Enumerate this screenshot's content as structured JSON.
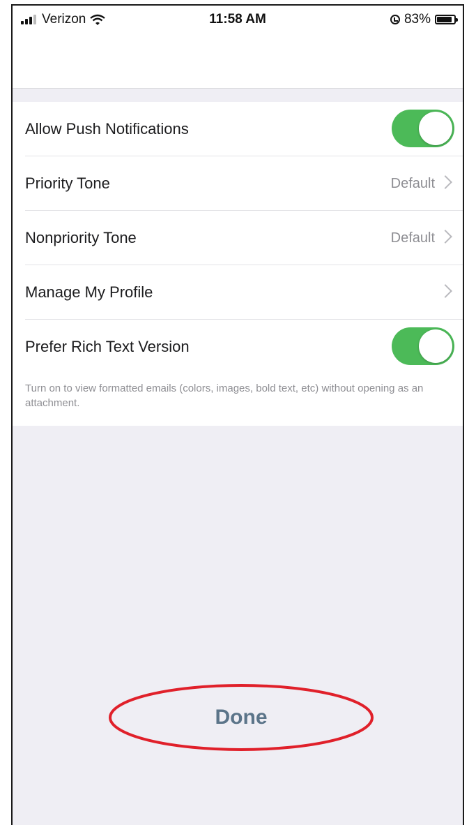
{
  "status_bar": {
    "carrier": "Verizon",
    "time": "11:58 AM",
    "battery": "83%"
  },
  "settings": {
    "rows": [
      {
        "label": "Allow Push Notifications",
        "control": "toggle",
        "on": true
      },
      {
        "label": "Priority Tone",
        "control": "value",
        "value": "Default"
      },
      {
        "label": "Nonpriority Tone",
        "control": "value",
        "value": "Default"
      },
      {
        "label": "Manage My Profile",
        "control": "chevron"
      },
      {
        "label": "Prefer Rich Text Version",
        "control": "toggle",
        "on": true
      }
    ],
    "footnote": "Turn on to view formatted emails (colors, images, bold text, etc) without opening as an attachment."
  },
  "done_label": "Done",
  "colors": {
    "toggle_on": "#4cba58",
    "done_text": "#5b7489",
    "annotation": "#e0202a",
    "background": "#efeef4"
  }
}
